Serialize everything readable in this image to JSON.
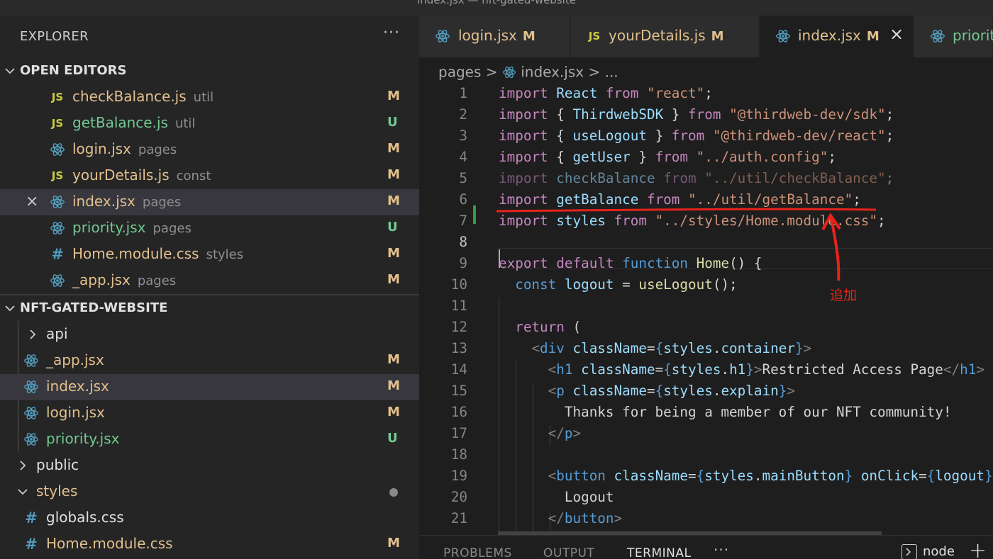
{
  "window": {
    "title": "index.jsx — nft-gated-website"
  },
  "explorer": {
    "header": "EXPLORER",
    "more_icon": "ellipsis-icon",
    "open_editors": {
      "title": "OPEN EDITORS",
      "items": [
        {
          "name": "checkBalance.js",
          "dir": "util",
          "status": "M",
          "icon": "js"
        },
        {
          "name": "getBalance.js",
          "dir": "util",
          "status": "U",
          "icon": "js"
        },
        {
          "name": "login.jsx",
          "dir": "pages",
          "status": "M",
          "icon": "react"
        },
        {
          "name": "yourDetails.js",
          "dir": "const",
          "status": "M",
          "icon": "js"
        },
        {
          "name": "index.jsx",
          "dir": "pages",
          "status": "M",
          "icon": "react",
          "close": "×"
        },
        {
          "name": "priority.jsx",
          "dir": "pages",
          "status": "U",
          "icon": "react"
        },
        {
          "name": "Home.module.css",
          "dir": "styles",
          "status": "M",
          "icon": "css"
        },
        {
          "name": "_app.jsx",
          "dir": "pages",
          "status": "M",
          "icon": "react"
        }
      ]
    },
    "project": {
      "title": "NFT-GATED-WEBSITE",
      "items": [
        {
          "name": "api",
          "type": "folder"
        },
        {
          "name": "_app.jsx",
          "status": "M",
          "icon": "react"
        },
        {
          "name": "index.jsx",
          "status": "M",
          "icon": "react"
        },
        {
          "name": "login.jsx",
          "status": "M",
          "icon": "react"
        },
        {
          "name": "priority.jsx",
          "status": "U",
          "icon": "react"
        },
        {
          "name": "public",
          "type": "folder"
        },
        {
          "name": "styles",
          "type": "folder-open"
        },
        {
          "name": "globals.css",
          "icon": "css"
        },
        {
          "name": "Home.module.css",
          "status": "M",
          "icon": "css"
        }
      ]
    }
  },
  "tabs": [
    {
      "name": "login.jsx",
      "status": "M",
      "icon": "react"
    },
    {
      "name": "yourDetails.js",
      "status": "M",
      "icon": "js"
    },
    {
      "name": "index.jsx",
      "status": "M",
      "icon": "react",
      "active": true,
      "close": "×"
    },
    {
      "name": "priority",
      "icon": "react"
    }
  ],
  "breadcrumb": {
    "folder": "pages",
    "sep": ">",
    "file": "index.jsx",
    "rest": "> ..."
  },
  "editor": {
    "cursor_line": 8,
    "line_numbers": [
      "1",
      "2",
      "3",
      "4",
      "5",
      "6",
      "7",
      "8",
      "9",
      "10",
      "11",
      "12",
      "13",
      "14",
      "15",
      "16",
      "17",
      "18",
      "19",
      "20",
      "21"
    ]
  },
  "panel": {
    "tabs": [
      "PROBLEMS",
      "OUTPUT",
      "TERMINAL"
    ],
    "active": "TERMINAL",
    "more": "···",
    "terminal_label": "node",
    "plus": "+"
  },
  "annotation": {
    "text": "追加",
    "color": "#e8231c"
  },
  "colors": {
    "modified": "#e2c08d",
    "untracked": "#73c991",
    "accent_selected": "#37373d"
  }
}
